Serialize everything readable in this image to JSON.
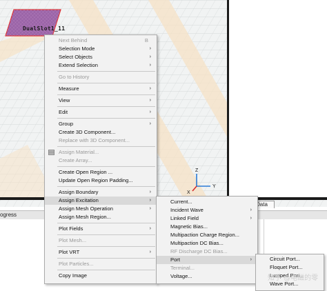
{
  "viewport": {
    "object_label": "DualSlot1_11",
    "data_tab_label": "Data",
    "progress_tab_label": "ogress",
    "axes": {
      "z": "Z",
      "y": "Y",
      "x": "X"
    }
  },
  "context_menu": {
    "items": [
      {
        "label": "Next Behind",
        "shortcut": "B",
        "disabled": true
      },
      {
        "label": "Selection Mode",
        "submenu": true
      },
      {
        "label": "Select Objects",
        "submenu": true
      },
      {
        "label": "Extend Selection",
        "submenu": true
      },
      {
        "separator": true
      },
      {
        "label": "Go to History",
        "disabled": true
      },
      {
        "separator": true
      },
      {
        "label": "Measure",
        "submenu": true
      },
      {
        "separator": true
      },
      {
        "label": "View",
        "submenu": true
      },
      {
        "separator": true
      },
      {
        "label": "Edit",
        "submenu": true
      },
      {
        "separator": true
      },
      {
        "label": "Group",
        "submenu": true
      },
      {
        "label": "Create 3D Component..."
      },
      {
        "label": "Replace with 3D Component...",
        "disabled": true
      },
      {
        "separator": true
      },
      {
        "label": "Assign Material...",
        "disabled": true,
        "icon": "material-icon"
      },
      {
        "label": "Create Array...",
        "disabled": true
      },
      {
        "separator": true
      },
      {
        "label": "Create Open Region ..."
      },
      {
        "label": "Update Open Region Padding..."
      },
      {
        "separator": true
      },
      {
        "label": "Assign Boundary",
        "submenu": true
      },
      {
        "label": "Assign Excitation",
        "submenu": true,
        "highlight": true
      },
      {
        "label": "Assign Mesh Operation",
        "submenu": true
      },
      {
        "label": "Assign Mesh Region..."
      },
      {
        "separator": true
      },
      {
        "label": "Plot Fields",
        "submenu": true
      },
      {
        "separator": true
      },
      {
        "label": "Plot Mesh...",
        "disabled": true
      },
      {
        "separator": true
      },
      {
        "label": "Plot VRT",
        "submenu": true
      },
      {
        "separator": true
      },
      {
        "label": "Plot Particles...",
        "disabled": true
      },
      {
        "separator": true
      },
      {
        "label": "Copy Image"
      }
    ]
  },
  "excitation_menu": {
    "items": [
      {
        "label": "Current..."
      },
      {
        "label": "Incident Wave",
        "submenu": true
      },
      {
        "label": "Linked Field",
        "submenu": true
      },
      {
        "label": "Magnetic Bias..."
      },
      {
        "label": "Multipaction Charge Region..."
      },
      {
        "label": "Multipaction DC Bias..."
      },
      {
        "label": "RF Discharge DC Bias...",
        "disabled": true
      },
      {
        "label": "Port",
        "submenu": true,
        "highlight": true
      },
      {
        "label": "Terminal...",
        "disabled": true
      },
      {
        "label": "Voltage..."
      }
    ]
  },
  "port_menu": {
    "items": [
      {
        "label": "Circuit Port..."
      },
      {
        "label": "Floquet Port..."
      },
      {
        "label": "Lumped Port..."
      },
      {
        "label": "Wave Port..."
      }
    ]
  },
  "watermark": "知乎 @电磁的零"
}
